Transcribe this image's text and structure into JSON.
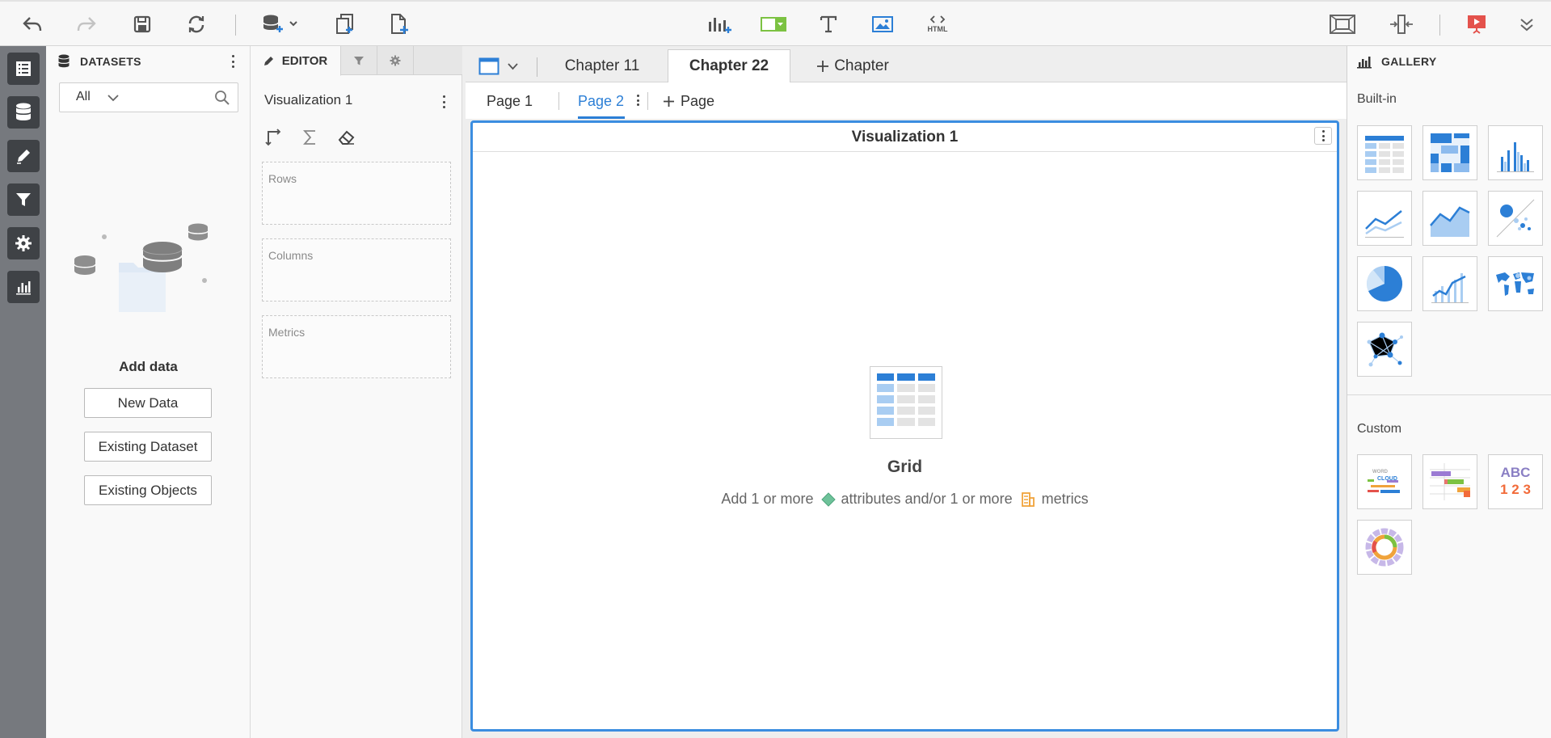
{
  "toolbar": {
    "buttons": [
      "undo-icon",
      "redo-icon",
      "save-icon",
      "refresh-icon",
      "add-data-icon",
      "duplicate-icon",
      "new-page-icon",
      "insert-visualization-icon",
      "filter-widget-icon",
      "text-icon",
      "image-icon",
      "html-icon",
      "fit-screen-icon",
      "resize-icon",
      "present-icon",
      "more-icon"
    ],
    "html_label": "HTML"
  },
  "rail": {
    "items": [
      "table-of-contents-icon",
      "datasets-icon",
      "editor-icon",
      "filter-icon",
      "format-icon",
      "gallery-icon"
    ]
  },
  "datasets": {
    "title": "DATASETS",
    "filter_value": "All",
    "add_data_title": "Add data",
    "buttons": [
      "New Data",
      "Existing Dataset",
      "Existing Objects"
    ]
  },
  "editor": {
    "tab_label": "EDITOR",
    "viz_name": "Visualization 1",
    "drop_zones": [
      "Rows",
      "Columns",
      "Metrics"
    ]
  },
  "chapters": {
    "tabs": [
      "Chapter 11",
      "Chapter 22"
    ],
    "active": "Chapter 22",
    "add_label": "Chapter"
  },
  "pages": {
    "tabs": [
      "Page 1",
      "Page 2"
    ],
    "active": "Page 2",
    "add_label": "Page"
  },
  "viz": {
    "title": "Visualization 1",
    "placeholder_title": "Grid",
    "hint_prefix": "Add 1 or more",
    "hint_attributes": "attributes and/or 1 or more",
    "hint_metrics": "metrics"
  },
  "gallery": {
    "title": "GALLERY",
    "builtin_label": "Built-in",
    "custom_label": "Custom",
    "builtin_items": [
      "grid",
      "heat-map",
      "bar-chart",
      "line-chart",
      "area-chart",
      "bubble-chart",
      "pie-chart",
      "combo-chart",
      "map",
      "network"
    ],
    "custom_items": [
      "word-cloud",
      "gantt",
      "kpi",
      "sunburst"
    ],
    "custom_word_cloud_text": [
      "WORD",
      "CLOUD"
    ],
    "custom_kpi_text": [
      "ABC",
      "1 2 3"
    ]
  },
  "colors": {
    "accent": "#3b8de0",
    "rail": "#76797e",
    "rail_button": "#3f4246",
    "attribute": "#6ec29a",
    "metric": "#f0a33b",
    "present": "#e4524c"
  }
}
